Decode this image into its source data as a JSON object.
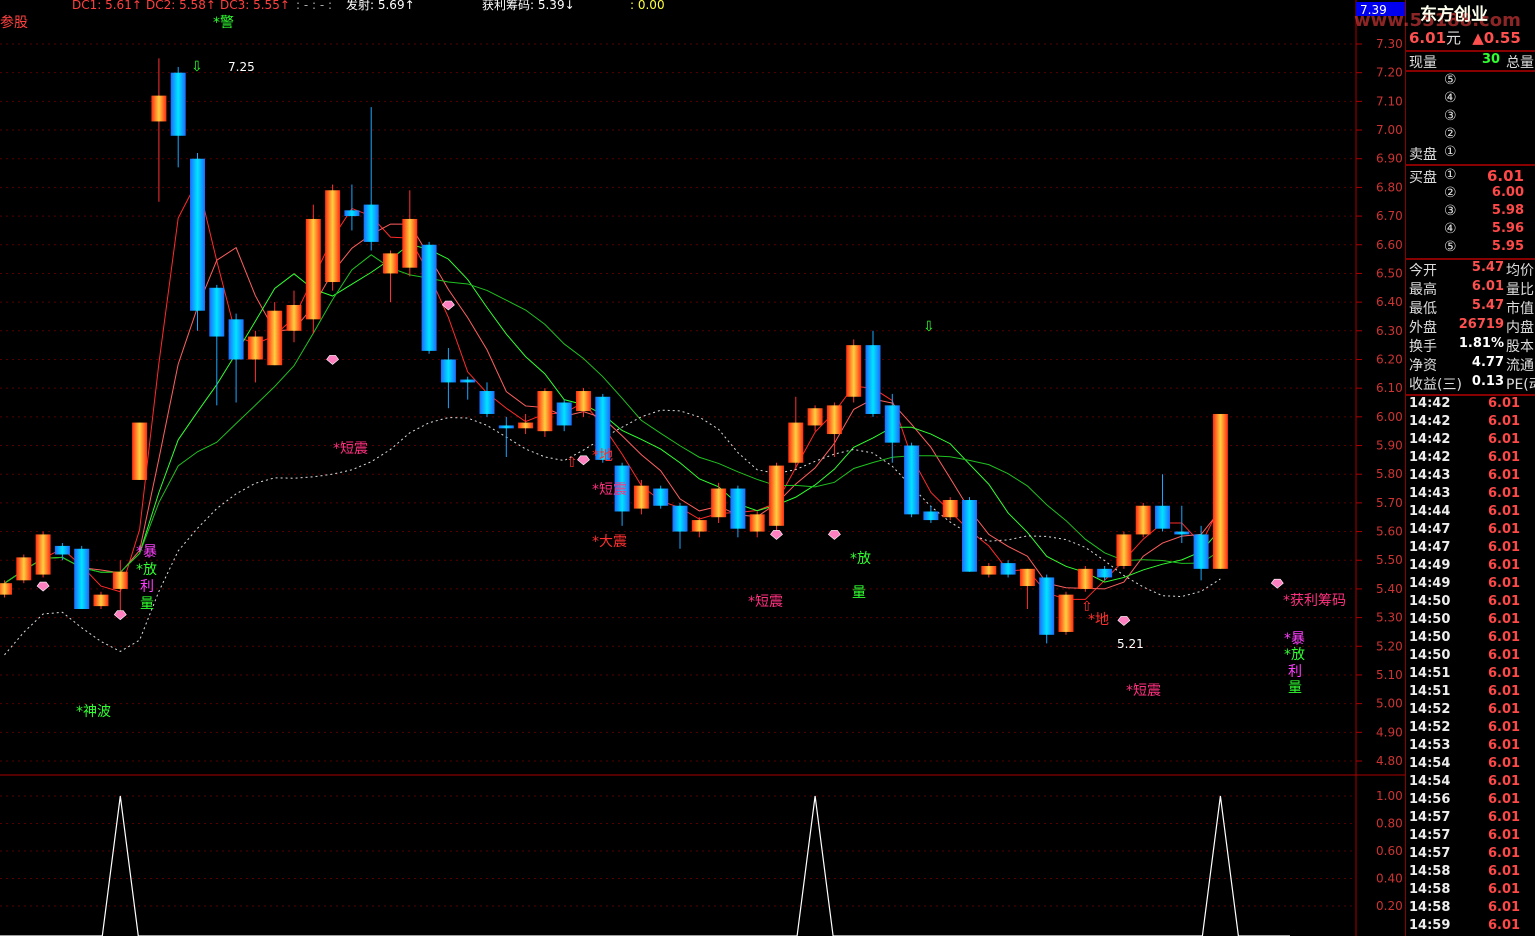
{
  "indicators": {
    "label_left": "参股",
    "dc1": "DC1: 5.61↑",
    "dc2": "DC2: 5.58↑",
    "dc3": "DC3: 5.55↑",
    "dots": ": - : - :",
    "fashe": "发射: 5.69↑",
    "huoli": "获利筹码: 5.39↓",
    "zero": ": 0.00"
  },
  "top_price_tag": "7.39",
  "header": {
    "company": "东方创业",
    "watermark": "www.55188.com",
    "price": "6.01",
    "unit": "元",
    "change": "▲0.55"
  },
  "volume_row": {
    "label_now": "现量",
    "value_now": "30",
    "label_total": "总量"
  },
  "asks": {
    "title": "卖盘",
    "levels": [
      "⑤",
      "④",
      "③",
      "②",
      "①"
    ]
  },
  "bids": {
    "title": "买盘",
    "levels": [
      {
        "n": "①",
        "price": "6.01"
      },
      {
        "n": "②",
        "price": "6.00"
      },
      {
        "n": "③",
        "price": "5.98"
      },
      {
        "n": "④",
        "price": "5.96"
      },
      {
        "n": "⑤",
        "price": "5.95"
      }
    ]
  },
  "stats": [
    {
      "label": "今开",
      "value": "5.47",
      "label2": "均价",
      "color": "#ff5050"
    },
    {
      "label": "最高",
      "value": "6.01",
      "label2": "量比",
      "color": "#ff5050"
    },
    {
      "label": "最低",
      "value": "5.47",
      "label2": "市值",
      "color": "#ff5050"
    },
    {
      "label": "外盘",
      "value": "26719",
      "label2": "内盘",
      "color": "#ff5050"
    },
    {
      "label": "换手",
      "value": "1.81%",
      "label2": "股本",
      "color": "#ffffff"
    },
    {
      "label": "净资",
      "value": "4.77",
      "label2": "流通",
      "color": "#ffffff"
    },
    {
      "label": "收益(三)",
      "value": "0.13",
      "label2": "PE(动",
      "color": "#ffffff"
    }
  ],
  "trades": [
    {
      "t": "14:42",
      "p": "6.01"
    },
    {
      "t": "14:42",
      "p": "6.01"
    },
    {
      "t": "14:42",
      "p": "6.01"
    },
    {
      "t": "14:42",
      "p": "6.01"
    },
    {
      "t": "14:43",
      "p": "6.01"
    },
    {
      "t": "14:43",
      "p": "6.01"
    },
    {
      "t": "14:44",
      "p": "6.01"
    },
    {
      "t": "14:47",
      "p": "6.01"
    },
    {
      "t": "14:47",
      "p": "6.01"
    },
    {
      "t": "14:49",
      "p": "6.01"
    },
    {
      "t": "14:49",
      "p": "6.01"
    },
    {
      "t": "14:50",
      "p": "6.01"
    },
    {
      "t": "14:50",
      "p": "6.01"
    },
    {
      "t": "14:50",
      "p": "6.01"
    },
    {
      "t": "14:50",
      "p": "6.01"
    },
    {
      "t": "14:51",
      "p": "6.01"
    },
    {
      "t": "14:51",
      "p": "6.01"
    },
    {
      "t": "14:52",
      "p": "6.01"
    },
    {
      "t": "14:52",
      "p": "6.01"
    },
    {
      "t": "14:53",
      "p": "6.01"
    },
    {
      "t": "14:54",
      "p": "6.01"
    },
    {
      "t": "14:54",
      "p": "6.01"
    },
    {
      "t": "14:56",
      "p": "6.01"
    },
    {
      "t": "14:57",
      "p": "6.01"
    },
    {
      "t": "14:57",
      "p": "6.01"
    },
    {
      "t": "14:57",
      "p": "6.01"
    },
    {
      "t": "14:58",
      "p": "6.01"
    },
    {
      "t": "14:58",
      "p": "6.01"
    },
    {
      "t": "14:58",
      "p": "6.01"
    },
    {
      "t": "14:59",
      "p": "6.01"
    }
  ],
  "main_axis_ticks": [
    "7.30",
    "7.20",
    "7.10",
    "7.00",
    "6.90",
    "6.80",
    "6.70",
    "6.60",
    "6.50",
    "6.40",
    "6.30",
    "6.20",
    "6.10",
    "6.00",
    "5.90",
    "5.80",
    "5.70",
    "5.60",
    "5.50",
    "5.40",
    "5.30",
    "5.20",
    "5.10",
    "5.00",
    "4.90",
    "4.80"
  ],
  "sub_axis_ticks": [
    "1.00",
    "0.80",
    "0.60",
    "0.40",
    "0.20"
  ],
  "annotations": {
    "hi_label": "7.25",
    "lo_label": "5.21",
    "jing": "*警",
    "duanzhen1": "*短震",
    "duanzhen2": "*短震",
    "duanzhen3": "*短震",
    "duanzhen4": "*短震",
    "dazhen": "*大震",
    "di1": "*地",
    "di2": "*地",
    "fang1": "*放",
    "liang1": "量",
    "shenbo": "*神波",
    "bao1": "*暴",
    "fang2": "*放",
    "li1": "利",
    "liang2": "量",
    "huoli": "*获利筹码",
    "bao2": "*暴",
    "fang3": "*放",
    "li2": "利",
    "liang3": "量"
  },
  "candles": [
    {
      "o": 5.38,
      "c": 5.42,
      "h": 5.43,
      "l": 5.37
    },
    {
      "o": 5.43,
      "c": 5.51,
      "h": 5.52,
      "l": 5.42
    },
    {
      "o": 5.45,
      "c": 5.59,
      "h": 5.6,
      "l": 5.44
    },
    {
      "o": 5.55,
      "c": 5.52,
      "h": 5.56,
      "l": 5.5
    },
    {
      "o": 5.54,
      "c": 5.33,
      "h": 5.55,
      "l": 5.33
    },
    {
      "o": 5.34,
      "c": 5.38,
      "h": 5.39,
      "l": 5.33
    },
    {
      "o": 5.4,
      "c": 5.46,
      "h": 5.5,
      "l": 5.32
    },
    {
      "o": 5.78,
      "c": 5.98,
      "h": 5.98,
      "l": 5.78
    },
    {
      "o": 7.03,
      "c": 7.12,
      "h": 7.25,
      "l": 6.75
    },
    {
      "o": 7.2,
      "c": 6.98,
      "h": 7.22,
      "l": 6.87
    },
    {
      "o": 6.9,
      "c": 6.37,
      "h": 6.92,
      "l": 6.3
    },
    {
      "o": 6.45,
      "c": 6.28,
      "h": 6.46,
      "l": 6.04
    },
    {
      "o": 6.34,
      "c": 6.2,
      "h": 6.36,
      "l": 6.05
    },
    {
      "o": 6.2,
      "c": 6.28,
      "h": 6.3,
      "l": 6.12
    },
    {
      "o": 6.18,
      "c": 6.37,
      "h": 6.4,
      "l": 6.18
    },
    {
      "o": 6.3,
      "c": 6.39,
      "h": 6.44,
      "l": 6.26
    },
    {
      "o": 6.34,
      "c": 6.69,
      "h": 6.74,
      "l": 6.29
    },
    {
      "o": 6.47,
      "c": 6.79,
      "h": 6.81,
      "l": 6.44
    },
    {
      "o": 6.72,
      "c": 6.7,
      "h": 6.81,
      "l": 6.65
    },
    {
      "o": 6.74,
      "c": 6.61,
      "h": 7.08,
      "l": 6.58
    },
    {
      "o": 6.5,
      "c": 6.57,
      "h": 6.58,
      "l": 6.4
    },
    {
      "o": 6.52,
      "c": 6.69,
      "h": 6.79,
      "l": 6.49
    },
    {
      "o": 6.6,
      "c": 6.23,
      "h": 6.61,
      "l": 6.22
    },
    {
      "o": 6.2,
      "c": 6.12,
      "h": 6.24,
      "l": 6.03
    },
    {
      "o": 6.13,
      "c": 6.12,
      "h": 6.14,
      "l": 6.06
    },
    {
      "o": 6.09,
      "c": 6.01,
      "h": 6.12,
      "l": 6.0
    },
    {
      "o": 5.97,
      "c": 5.96,
      "h": 6.0,
      "l": 5.86
    },
    {
      "o": 5.96,
      "c": 5.98,
      "h": 6.01,
      "l": 5.94
    },
    {
      "o": 5.95,
      "c": 6.09,
      "h": 6.1,
      "l": 5.93
    },
    {
      "o": 6.05,
      "c": 5.97,
      "h": 6.06,
      "l": 5.95
    },
    {
      "o": 6.02,
      "c": 6.09,
      "h": 6.1,
      "l": 6.0
    },
    {
      "o": 6.07,
      "c": 5.85,
      "h": 6.08,
      "l": 5.84
    },
    {
      "o": 5.83,
      "c": 5.67,
      "h": 5.84,
      "l": 5.62
    },
    {
      "o": 5.68,
      "c": 5.76,
      "h": 5.78,
      "l": 5.66
    },
    {
      "o": 5.75,
      "c": 5.69,
      "h": 5.76,
      "l": 5.68
    },
    {
      "o": 5.69,
      "c": 5.6,
      "h": 5.7,
      "l": 5.54
    },
    {
      "o": 5.6,
      "c": 5.64,
      "h": 5.65,
      "l": 5.58
    },
    {
      "o": 5.65,
      "c": 5.75,
      "h": 5.77,
      "l": 5.63
    },
    {
      "o": 5.75,
      "c": 5.61,
      "h": 5.76,
      "l": 5.58
    },
    {
      "o": 5.6,
      "c": 5.66,
      "h": 5.67,
      "l": 5.58
    },
    {
      "o": 5.62,
      "c": 5.83,
      "h": 5.84,
      "l": 5.6
    },
    {
      "o": 5.84,
      "c": 5.98,
      "h": 6.07,
      "l": 5.82
    },
    {
      "o": 5.97,
      "c": 6.03,
      "h": 6.04,
      "l": 5.95
    },
    {
      "o": 5.94,
      "c": 6.04,
      "h": 6.05,
      "l": 5.86
    },
    {
      "o": 6.07,
      "c": 6.25,
      "h": 6.27,
      "l": 6.05
    },
    {
      "o": 6.25,
      "c": 6.01,
      "h": 6.3,
      "l": 6.0
    },
    {
      "o": 6.04,
      "c": 5.91,
      "h": 6.08,
      "l": 5.84
    },
    {
      "o": 5.9,
      "c": 5.66,
      "h": 5.91,
      "l": 5.65
    },
    {
      "o": 5.67,
      "c": 5.64,
      "h": 5.69,
      "l": 5.63
    },
    {
      "o": 5.65,
      "c": 5.71,
      "h": 5.72,
      "l": 5.64
    },
    {
      "o": 5.71,
      "c": 5.46,
      "h": 5.72,
      "l": 5.46
    },
    {
      "o": 5.45,
      "c": 5.48,
      "h": 5.49,
      "l": 5.44
    },
    {
      "o": 5.49,
      "c": 5.45,
      "h": 5.5,
      "l": 5.44
    },
    {
      "o": 5.41,
      "c": 5.47,
      "h": 5.47,
      "l": 5.33
    },
    {
      "o": 5.44,
      "c": 5.24,
      "h": 5.45,
      "l": 5.21
    },
    {
      "o": 5.25,
      "c": 5.38,
      "h": 5.39,
      "l": 5.24
    },
    {
      "o": 5.4,
      "c": 5.47,
      "h": 5.48,
      "l": 5.39
    },
    {
      "o": 5.47,
      "c": 5.44,
      "h": 5.48,
      "l": 5.43
    },
    {
      "o": 5.48,
      "c": 5.59,
      "h": 5.6,
      "l": 5.47
    },
    {
      "o": 5.59,
      "c": 5.69,
      "h": 5.7,
      "l": 5.58
    },
    {
      "o": 5.69,
      "c": 5.61,
      "h": 5.8,
      "l": 5.6
    },
    {
      "o": 5.6,
      "c": 5.59,
      "h": 5.69,
      "l": 5.56
    },
    {
      "o": 5.59,
      "c": 5.47,
      "h": 5.62,
      "l": 5.43
    },
    {
      "o": 5.47,
      "c": 6.01,
      "h": 6.01,
      "l": 5.47
    }
  ],
  "sub_signal": [
    {
      "i": 6,
      "v": 1.0
    },
    {
      "i": 42,
      "v": 1.0
    },
    {
      "i": 63,
      "v": 1.0
    }
  ],
  "colors": {
    "up_a": "#ff2020",
    "up_b": "#ffdd55",
    "down_a": "#00c8ff",
    "down_b": "#0040ff",
    "axis": "#cc2222",
    "ma1": "#ff3030",
    "ma2": "#ff8080",
    "ma3": "#30ff30",
    "ma4": "#10c010",
    "dotted": "#eeeeee"
  }
}
